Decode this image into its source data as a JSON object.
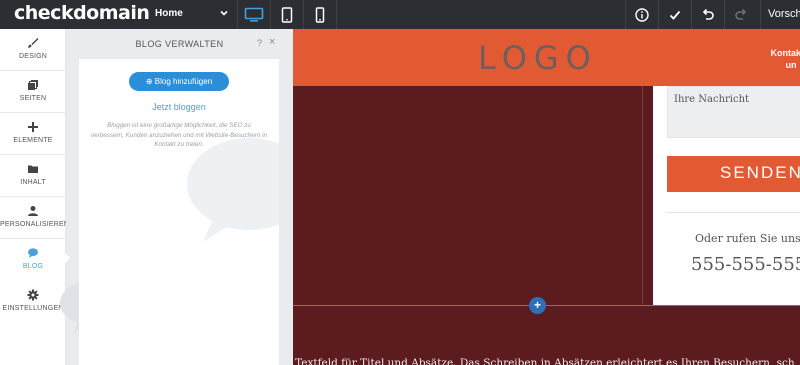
{
  "topbar": {
    "brand": "checkdomain",
    "page_select": "Home",
    "preview_label": "Vorscha",
    "colors": {
      "bg": "#2b2f33",
      "active": "#4a9fd8"
    }
  },
  "leftnav": {
    "items": [
      {
        "label": "DESIGN",
        "icon": "brush-icon"
      },
      {
        "label": "SEITEN",
        "icon": "pages-icon"
      },
      {
        "label": "ELEMENTE",
        "icon": "plus-icon"
      },
      {
        "label": "INHALT",
        "icon": "folder-icon"
      },
      {
        "label": "PERSONALISIEREN",
        "icon": "person-icon"
      },
      {
        "label": "BLOG",
        "icon": "chat-bubble-icon",
        "active": true
      },
      {
        "label": "EINSTELLUNGEN",
        "icon": "gear-icon"
      }
    ]
  },
  "panel": {
    "title": "BLOG VERWALTEN",
    "help": "?",
    "close": "×",
    "add_button": "Blog hinzufügen",
    "start_link": "Jetzt bloggen",
    "description": "Bloggen ist eine großartige Möglichkeit, die SEO zu verbessern, Kunden anzuziehen und mit Website-Besuchern in Kontakt zu treten."
  },
  "site": {
    "logo": "LOGO",
    "contact_link_line1": "Kontaktie",
    "contact_link_line2": "un",
    "message_placeholder": "Ihre Nachricht",
    "send_button": "SENDEN",
    "call_text": "Oder rufen Sie uns a",
    "phone": "555-555-555",
    "body_text": "n Textfeld für Titel und Absätze. Das Schreiben in Absätzen erleichtert es Ihren Besuchern, sch",
    "add_section": "+",
    "colors": {
      "header": "#e15a34",
      "background": "#5c1b1f"
    }
  }
}
